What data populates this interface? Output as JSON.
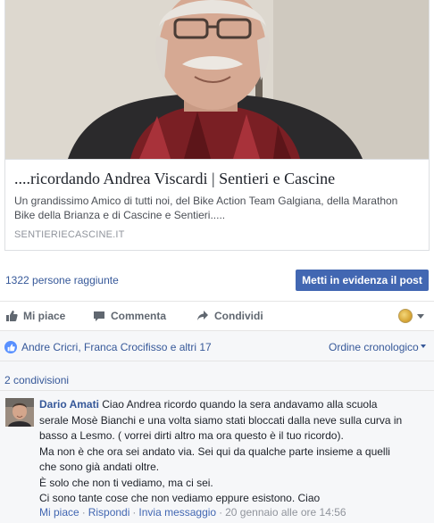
{
  "link_preview": {
    "title": "....ricordando Andrea Viscardi | Sentieri e Cascine",
    "description": "Un grandissimo Amico di tutti noi, del Bike Action Team Galgiana, della Marathon Bike della Brianza e di Cascine e Sentieri.....",
    "domain": "SENTIERIECASCINE.IT"
  },
  "reach": {
    "text": "1322 persone raggiunte",
    "boost_label": "Metti in evidenza il post"
  },
  "actions": {
    "like_label": "Mi piace",
    "comment_label": "Commenta",
    "share_label": "Condividi",
    "audience_icon": "globe-icon"
  },
  "reactions": {
    "likes_text": "Andre Cricri, Franca Crocifisso e altri 17",
    "order_label": "Ordine cronologico"
  },
  "shares": {
    "text": "2 condivisioni"
  },
  "comment": {
    "author": "Dario Amati",
    "lines": [
      "Ciao Andrea ricordo quando la sera andavamo alla scuola",
      "serale Mosè Bianchi e una volta siamo stati bloccati dalla neve sulla curva in",
      "basso a Lesmo. ( vorrei dirti altro ma ora questo è il tuo ricordo).",
      "Ma non è che ora sei andato via. Sei qui da qualche parte insieme a quelli",
      "che sono già andati oltre.",
      "È solo che non ti vediamo, ma ci sei.",
      "Ci sono tante cose che non vediamo eppure esistono. Ciao"
    ],
    "like_link": "Mi piace",
    "reply_link": "Rispondi",
    "message_link": "Invia messaggio",
    "timestamp": "20 gennaio alle ore 14:56",
    "separator": "·"
  },
  "colors": {
    "link_blue": "#365899",
    "button_blue": "#4267b2",
    "like_badge": "#5890ff",
    "muted_text": "#90949c"
  }
}
